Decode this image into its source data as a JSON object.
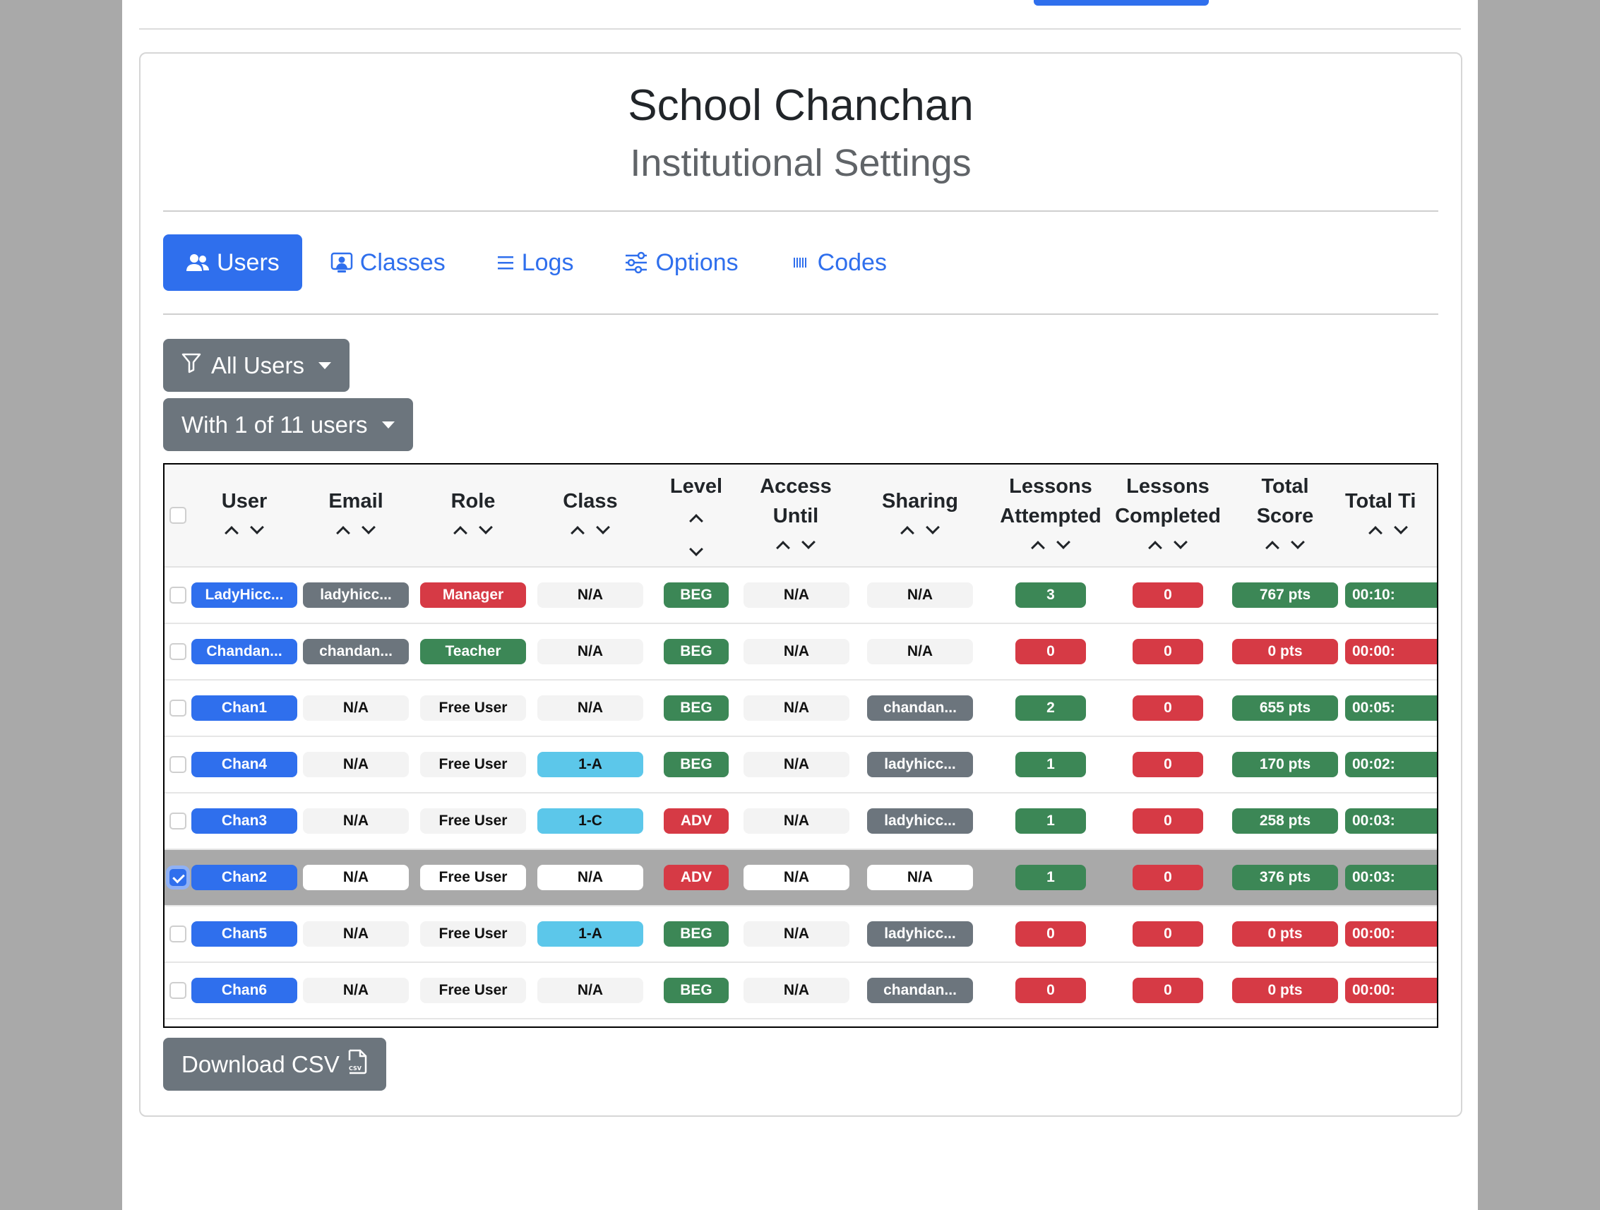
{
  "header": {
    "school_name": "School Chanchan",
    "subtitle": "Institutional Settings"
  },
  "tabs": [
    {
      "label": "Users",
      "icon": "users-icon",
      "active": true
    },
    {
      "label": "Classes",
      "icon": "person-badge-icon",
      "active": false
    },
    {
      "label": "Logs",
      "icon": "list-icon",
      "active": false
    },
    {
      "label": "Options",
      "icon": "sliders-icon",
      "active": false
    },
    {
      "label": "Codes",
      "icon": "barcode-icon",
      "active": false
    }
  ],
  "filter_dropdown": {
    "label": "All Users",
    "icon": "funnel-icon"
  },
  "selection_dropdown": {
    "label": "With 1 of 11 users"
  },
  "table": {
    "columns": [
      "User",
      "Email",
      "Role",
      "Class",
      "Level",
      "Access Until",
      "Sharing",
      "Lessons Attempted",
      "Lessons Completed",
      "Total Score",
      "Total Ti"
    ],
    "rows": [
      {
        "checked": false,
        "user": "LadyHicc...",
        "email": "ladyhicc...",
        "role": "Manager",
        "class": "N/A",
        "level": "BEG",
        "access": "N/A",
        "sharing": "N/A",
        "attempted": "3",
        "completed": "0",
        "score": "767 pts",
        "time": "00:10:"
      },
      {
        "checked": false,
        "user": "Chandan...",
        "email": "chandan...",
        "role": "Teacher",
        "class": "N/A",
        "level": "BEG",
        "access": "N/A",
        "sharing": "N/A",
        "attempted": "0",
        "completed": "0",
        "score": "0 pts",
        "time": "00:00:"
      },
      {
        "checked": false,
        "user": "Chan1",
        "email": "N/A",
        "role": "Free User",
        "class": "N/A",
        "level": "BEG",
        "access": "N/A",
        "sharing": "chandan...",
        "attempted": "2",
        "completed": "0",
        "score": "655 pts",
        "time": "00:05:"
      },
      {
        "checked": false,
        "user": "Chan4",
        "email": "N/A",
        "role": "Free User",
        "class": "1-A",
        "level": "BEG",
        "access": "N/A",
        "sharing": "ladyhicc...",
        "attempted": "1",
        "completed": "0",
        "score": "170 pts",
        "time": "00:02:"
      },
      {
        "checked": false,
        "user": "Chan3",
        "email": "N/A",
        "role": "Free User",
        "class": "1-C",
        "level": "ADV",
        "access": "N/A",
        "sharing": "ladyhicc...",
        "attempted": "1",
        "completed": "0",
        "score": "258 pts",
        "time": "00:03:"
      },
      {
        "checked": true,
        "user": "Chan2",
        "email": "N/A",
        "role": "Free User",
        "class": "N/A",
        "level": "ADV",
        "access": "N/A",
        "sharing": "N/A",
        "attempted": "1",
        "completed": "0",
        "score": "376 pts",
        "time": "00:03:"
      },
      {
        "checked": false,
        "user": "Chan5",
        "email": "N/A",
        "role": "Free User",
        "class": "1-A",
        "level": "BEG",
        "access": "N/A",
        "sharing": "ladyhicc...",
        "attempted": "0",
        "completed": "0",
        "score": "0 pts",
        "time": "00:00:"
      },
      {
        "checked": false,
        "user": "Chan6",
        "email": "N/A",
        "role": "Free User",
        "class": "N/A",
        "level": "BEG",
        "access": "N/A",
        "sharing": "chandan...",
        "attempted": "0",
        "completed": "0",
        "score": "0 pts",
        "time": "00:00:"
      }
    ]
  },
  "download_button": {
    "label": "Download CSV",
    "icon": "csv-file-icon"
  },
  "colors": {
    "primary": "#2f6fed",
    "secondary": "#6c757d",
    "danger": "#d63a45",
    "success": "#3c8756",
    "info": "#5cc7ea"
  }
}
